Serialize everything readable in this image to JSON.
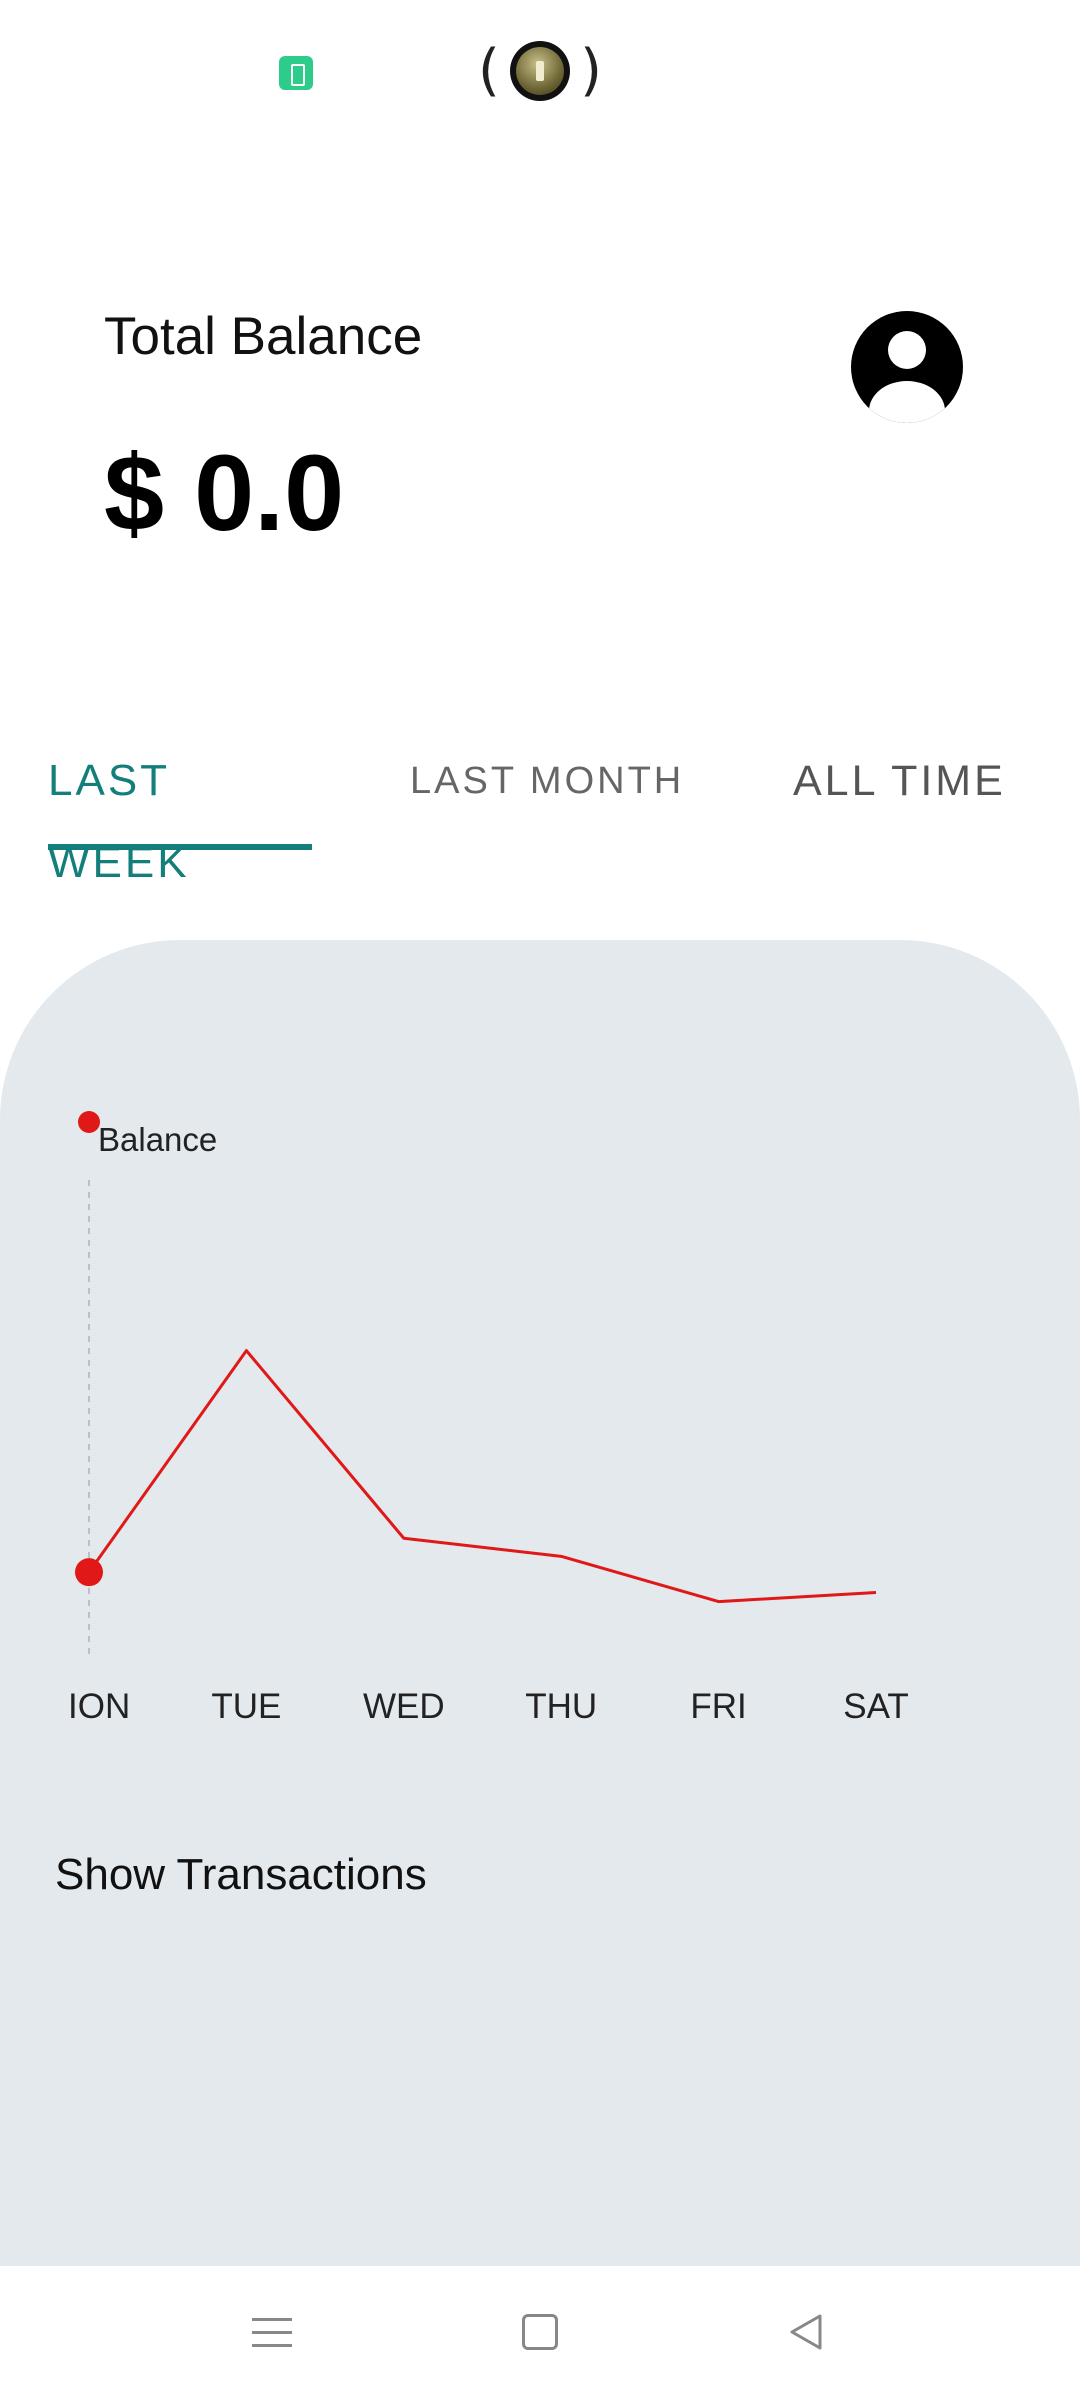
{
  "header": {
    "balance_label": "Total Balance",
    "balance_value": "$ 0.0"
  },
  "tabs": [
    {
      "label": "LAST WEEK",
      "selected": true
    },
    {
      "label": "LAST MONTH",
      "selected": false
    },
    {
      "label": "ALL TIME",
      "selected": false
    }
  ],
  "chart_data": {
    "type": "line",
    "categories": [
      "MON",
      "TUE",
      "WED",
      "THU",
      "FRI",
      "SAT"
    ],
    "visible_tick_labels": [
      "ION",
      "TUE",
      "WED",
      "THU",
      "FRI",
      "SAT"
    ],
    "series": [
      {
        "name": "Balance",
        "values": [
          0.0,
          0.98,
          0.15,
          0.07,
          -0.13,
          -0.09
        ],
        "color": "#e01818"
      }
    ],
    "ylim": [
      -0.3,
      2.0
    ],
    "grid": false,
    "legend": "top-left",
    "highlighted_category": "MON"
  },
  "actions": {
    "show_transactions": "Show Transactions"
  },
  "icons": {
    "status_left": "battery-icon",
    "status_center": "torch-icon",
    "avatar": "account-icon",
    "nav": [
      "menu-icon",
      "home-icon",
      "back-icon"
    ]
  },
  "colors": {
    "accent": "#137f7a",
    "card_bg": "#e3e9ed",
    "series": "#e01818"
  }
}
